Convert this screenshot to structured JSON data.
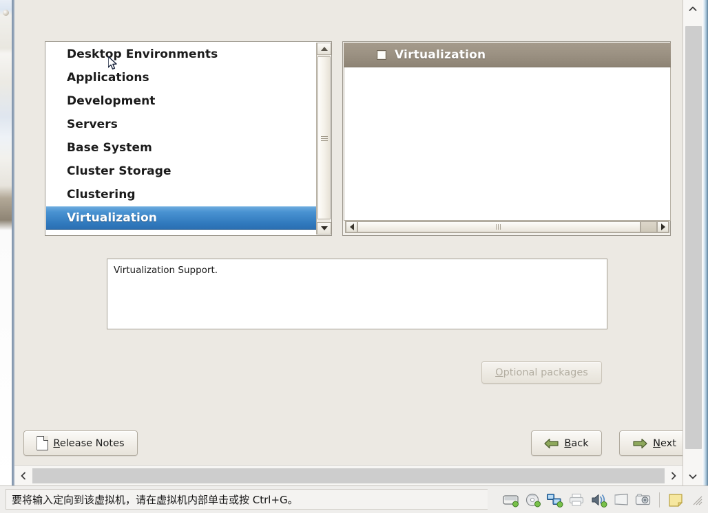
{
  "installer": {
    "group_list": {
      "name": "package-group-list",
      "items": [
        {
          "label": "Desktop Environments",
          "selected": false
        },
        {
          "label": "Applications",
          "selected": false
        },
        {
          "label": "Development",
          "selected": false
        },
        {
          "label": "Servers",
          "selected": false
        },
        {
          "label": "Base System",
          "selected": false
        },
        {
          "label": "Cluster Storage",
          "selected": false
        },
        {
          "label": "Clustering",
          "selected": false
        },
        {
          "label": "Virtualization",
          "selected": true
        }
      ]
    },
    "package_panel": {
      "header_title": "Virtualization",
      "header_checked": true,
      "packages": []
    },
    "description": "Virtualization Support.",
    "buttons": {
      "optional_packages": "Optional packages",
      "optional_packages_mnemonic": "O",
      "optional_packages_rest": "ptional packages",
      "optional_packages_enabled": false,
      "release_notes_mnemonic": "R",
      "release_notes_rest": "elease Notes",
      "back_mnemonic": "B",
      "back_rest": "ack",
      "next_mnemonic": "N",
      "next_rest": "ext"
    }
  },
  "vm_host": {
    "status_message": "要将输入定向到该虚拟机，请在虚拟机内部单击或按 Ctrl+G。",
    "status_icons": [
      "harddisk-icon",
      "cdrom-icon",
      "network-icon",
      "printer-icon",
      "sound-icon",
      "usb-display-icon",
      "camera-icon",
      "note-icon"
    ]
  },
  "colors": {
    "selection_blue_top": "#6aa9dd",
    "selection_blue_bottom": "#2b6fb2",
    "header_brown_top": "#a59b8c",
    "header_brown_bottom": "#8e8475",
    "dialog_background": "#ece9e3",
    "arrow_green": "#7f9a4e",
    "note_yellow": "#f3e6a8"
  }
}
